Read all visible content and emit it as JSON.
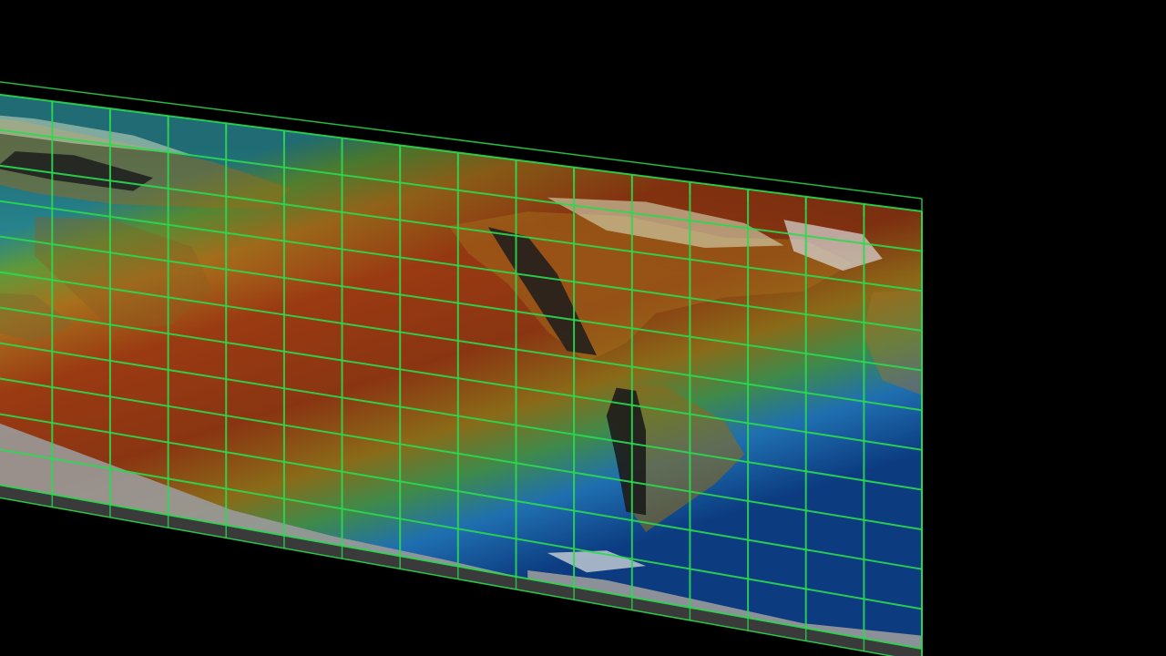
{
  "viewport": {
    "background": "#000000"
  },
  "map": {
    "colormap": [
      "#08306b",
      "#1f6fb0",
      "#2a9a9a",
      "#6f9a2a",
      "#a8781a",
      "#9a3a12",
      "#8a2a0e"
    ],
    "ice_color": "#9a9a9a",
    "land_shadow_color": "#1c1c1c",
    "land_highlight_color": "#dfe9c8"
  },
  "grid": {
    "color": "#2bd94f",
    "columns": 17,
    "rows": 11,
    "vertical_ticks": true
  }
}
